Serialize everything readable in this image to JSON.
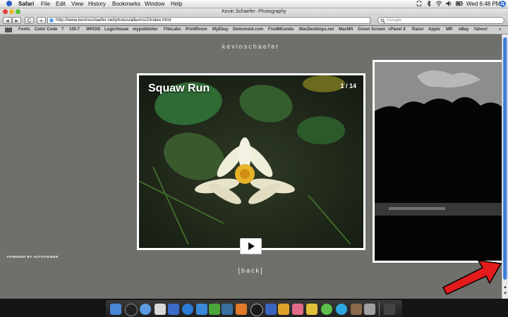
{
  "menubar": {
    "app_name": "Safari",
    "items": [
      "File",
      "Edit",
      "View",
      "History",
      "Bookmarks",
      "Window",
      "Help"
    ],
    "clock": "Wed 6:48 PM"
  },
  "window": {
    "title": "Kevin Schaefer- Photography"
  },
  "toolbar": {
    "back_label": "◂",
    "forward_label": "▸",
    "reload_label": "C",
    "add_label": "+",
    "url": "http://www.kevinschaefer.net/photos/albums/2/index.html",
    "search_placeholder": "Google"
  },
  "bookmarks": [
    "Fonts",
    "Color Code",
    "?",
    "100.7",
    "WHOIS",
    "LogicHouse",
    "mypublisher",
    "FileLabs",
    "PrintRoom",
    "MyEbay",
    "Demonoid.com",
    "FredMiranda",
    "MacDesktops.net",
    "MacNN",
    "Green Screen",
    "cPanel X",
    "Razor",
    "Apple",
    "MR",
    "eBay",
    "Yahoo!"
  ],
  "page": {
    "site_title": "kevinschaefer",
    "photo_title": "Squaw Run",
    "photo_counter": "1 / 14",
    "powered_by": "POWERED BY AUTOVIEWER",
    "back_link": "[back]"
  },
  "colors": {
    "page_background": "#6f6f6b",
    "scroll_thumb": "#2f6fd3",
    "annotation_arrow": "#e21b1b"
  }
}
